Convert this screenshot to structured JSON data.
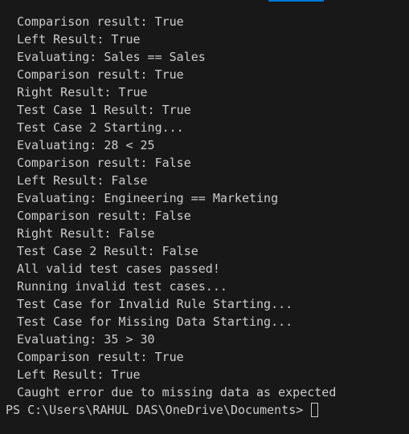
{
  "terminal": {
    "lines": [
      "Comparison result: True",
      "Left Result: True",
      "Evaluating: Sales == Sales",
      "Comparison result: True",
      "Right Result: True",
      "Test Case 1 Result: True",
      "Test Case 2 Starting...",
      "Evaluating: 28 < 25",
      "Comparison result: False",
      "Left Result: False",
      "Evaluating: Engineering == Marketing",
      "Comparison result: False",
      "Right Result: False",
      "Test Case 2 Result: False",
      "All valid test cases passed!",
      "Running invalid test cases...",
      "Test Case for Invalid Rule Starting...",
      "Test Case for Missing Data Starting...",
      "Evaluating: 35 > 30",
      "Comparison result: True",
      "Left Result: True",
      "Caught error due to missing data as expected"
    ],
    "prompt": "PS C:\\Users\\RAHUL DAS\\OneDrive\\Documents> "
  },
  "colors": {
    "background": "#181818",
    "foreground": "#cccccc",
    "accent": "#0078d4"
  }
}
